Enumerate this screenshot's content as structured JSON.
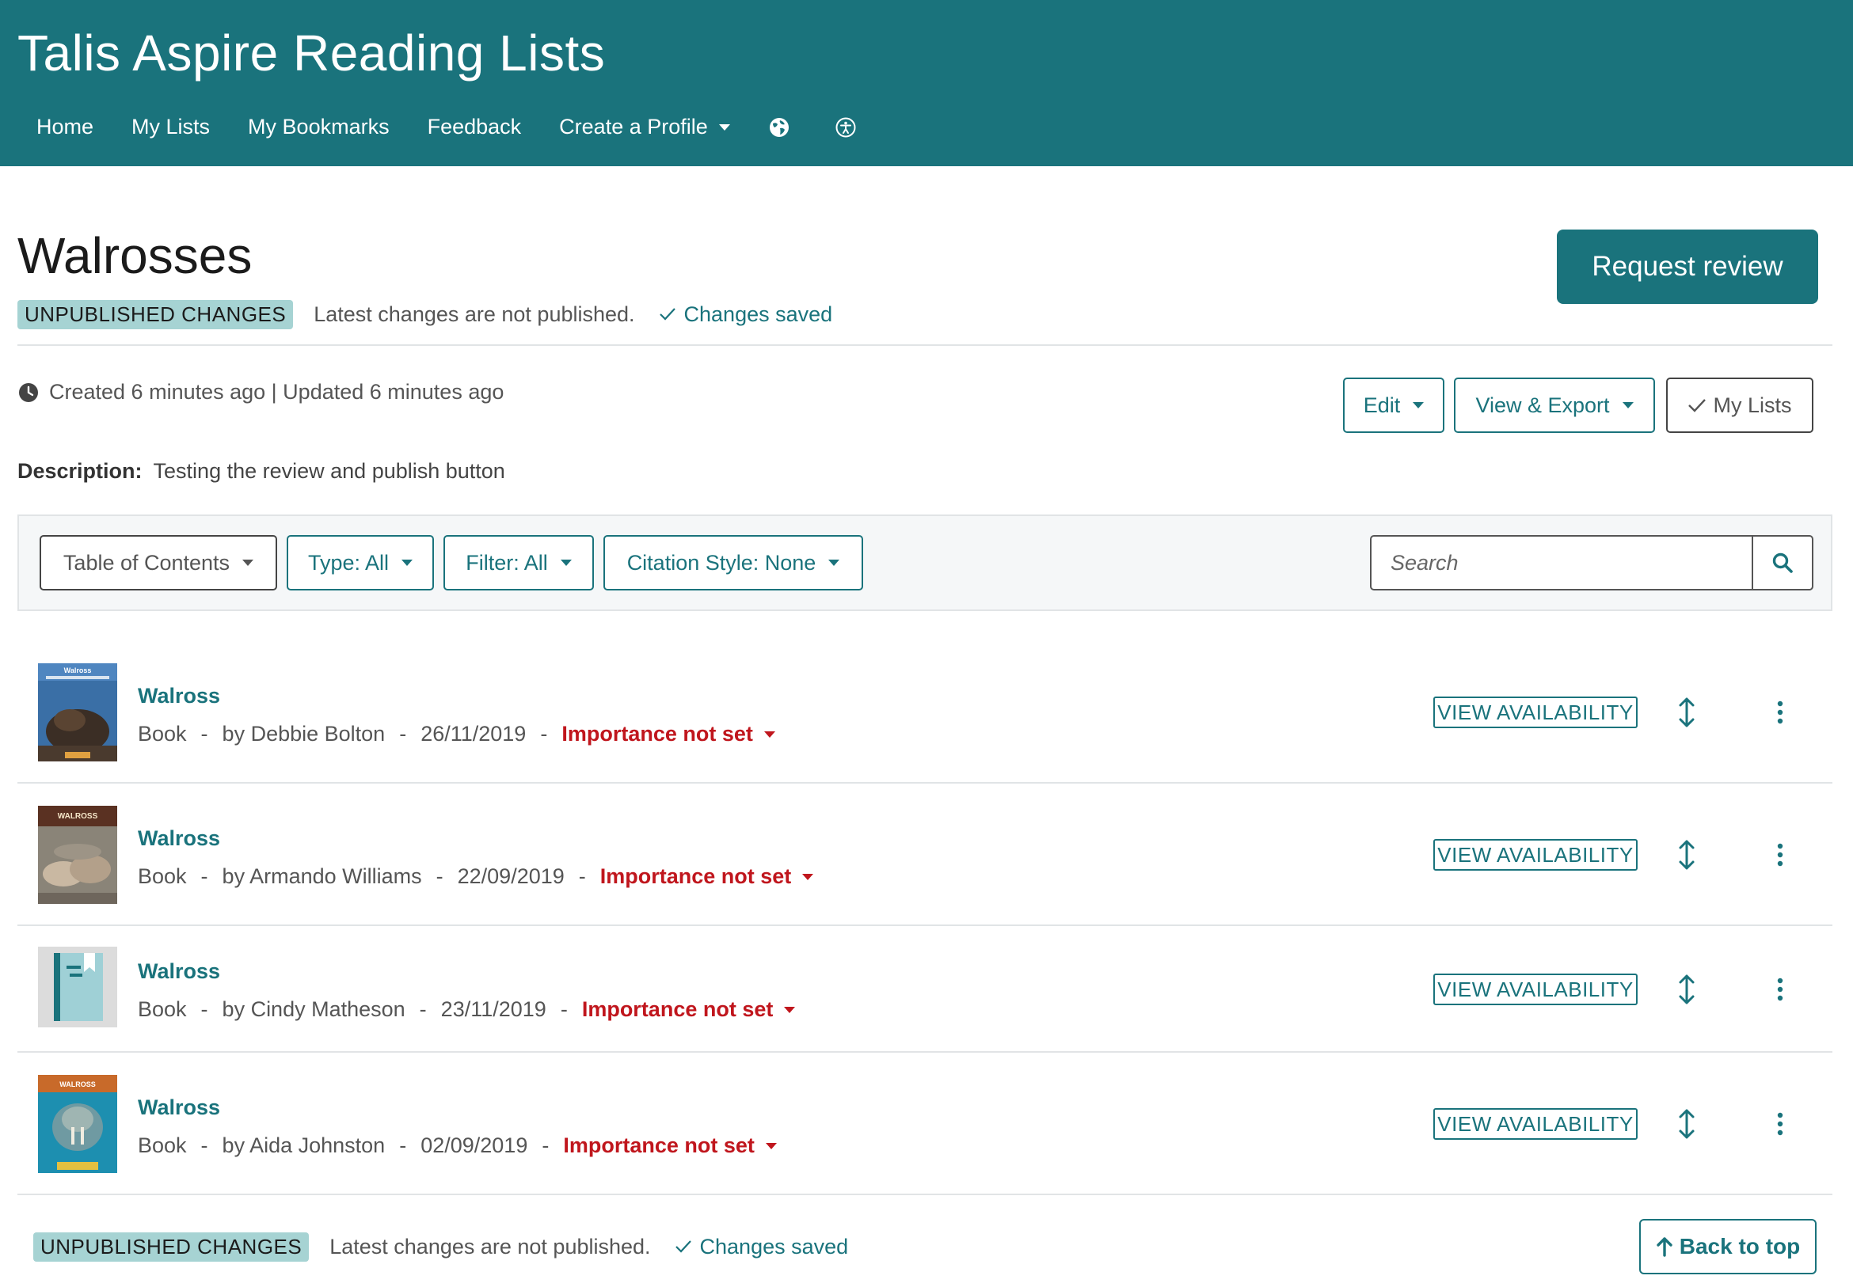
{
  "app": {
    "title": "Talis Aspire Reading Lists"
  },
  "nav": {
    "home": "Home",
    "my_lists": "My Lists",
    "my_bookmarks": "My Bookmarks",
    "feedback": "Feedback",
    "create_profile": "Create a Profile",
    "icons": [
      "globe-icon",
      "accessibility-icon"
    ]
  },
  "list": {
    "title": "Walrosses",
    "status_badge": "UNPUBLISHED CHANGES",
    "status_text": "Latest changes are not published.",
    "saved_text": "Changes saved",
    "request_review": "Request review",
    "timestamps": "Created 6 minutes ago | Updated 6 minutes ago",
    "description_label": "Description:",
    "description": "Testing the review and publish button"
  },
  "actions": {
    "edit": "Edit",
    "view_export": "View & Export",
    "my_lists": "My Lists"
  },
  "toolbar": {
    "table_of_contents": "Table of Contents",
    "type": "Type: All",
    "filter": "Filter: All",
    "citation_style": "Citation Style: None",
    "search_placeholder": "Search"
  },
  "items": [
    {
      "title": "Walross",
      "type": "Book",
      "author": "by Debbie Bolton",
      "date": "26/11/2019",
      "importance": "Importance not set",
      "availability": "VIEW AVAILABILITY",
      "thumb_text": "Walross"
    },
    {
      "title": "Walross",
      "type": "Book",
      "author": "by Armando Williams",
      "date": "22/09/2019",
      "importance": "Importance not set",
      "availability": "VIEW AVAILABILITY",
      "thumb_text": "WALROSS"
    },
    {
      "title": "Walross",
      "type": "Book",
      "author": "by Cindy Matheson",
      "date": "23/11/2019",
      "importance": "Importance not set",
      "availability": "VIEW AVAILABILITY",
      "thumb_text": ""
    },
    {
      "title": "Walross",
      "type": "Book",
      "author": "by Aida Johnston",
      "date": "02/09/2019",
      "importance": "Importance not set",
      "availability": "VIEW AVAILABILITY",
      "thumb_text": "WALROSS"
    }
  ],
  "footer": {
    "status_badge": "UNPUBLISHED CHANGES",
    "status_text": "Latest changes are not published.",
    "saved_text": "Changes saved",
    "back_to_top": "Back to top"
  },
  "colors": {
    "brand": "#1a737c",
    "badge_bg": "#a6d3d3",
    "importance": "#c0161d"
  }
}
